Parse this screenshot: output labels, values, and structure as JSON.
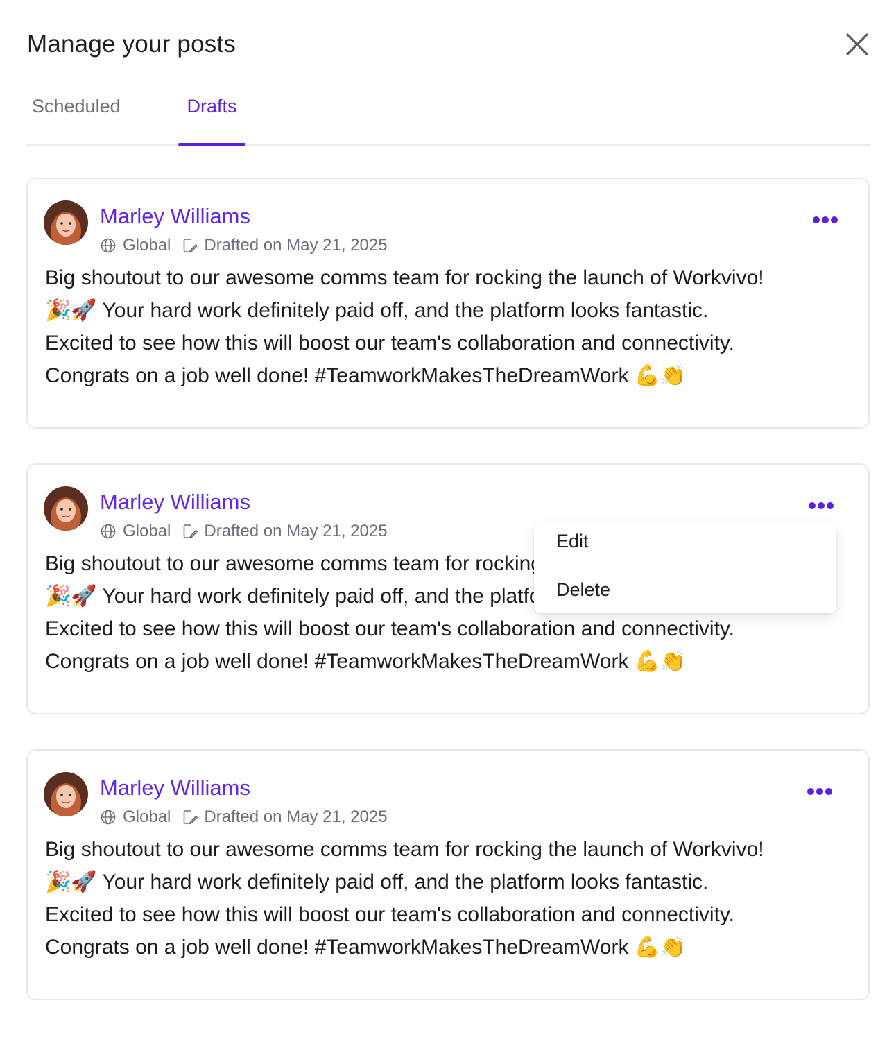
{
  "modal": {
    "title": "Manage your posts",
    "close_icon": "close-icon"
  },
  "tabs": [
    {
      "label": "Scheduled",
      "active": false
    },
    {
      "label": "Drafts",
      "active": true
    }
  ],
  "posts": [
    {
      "author": "Marley Williams",
      "audience": "Global",
      "status": "Drafted on May 21, 2025",
      "lines": [
        "Big shoutout to our awesome comms team for rocking the launch of Workvivo!",
        "🎉🚀 Your hard work definitely paid off, and the platform looks fantastic.",
        "Excited to see how this will boost our team's collaboration and connectivity.",
        "Congrats on a job well done! #TeamworkMakesTheDreamWork 💪👏"
      ]
    },
    {
      "author": "Marley Williams",
      "audience": "Global",
      "status": "Drafted on May 21, 2025",
      "lines": [
        "Big shoutout to our awesome comms team for rocking the launch of Workvivo!",
        "🎉🚀 Your hard work definitely paid off, and the platform looks fantastic.",
        "Excited to see how this will boost our team's collaboration and connectivity.",
        "Congrats on a job well done! #TeamworkMakesTheDreamWork 💪👏"
      ]
    },
    {
      "author": "Marley Williams",
      "audience": "Global",
      "status": "Drafted on May 21, 2025",
      "lines": [
        "Big shoutout to our awesome comms team for rocking the launch of Workvivo!",
        "🎉🚀 Your hard work definitely paid off, and the platform looks fantastic.",
        "Excited to see how this will boost our team's collaboration and connectivity.",
        "Congrats on a job well done! #TeamworkMakesTheDreamWork 💪👏"
      ]
    }
  ],
  "post_menu": {
    "edit": "Edit",
    "delete": "Delete"
  },
  "colors": {
    "accent": "#5d1fe0",
    "author": "#6226e6",
    "muted": "#6e6e78"
  }
}
